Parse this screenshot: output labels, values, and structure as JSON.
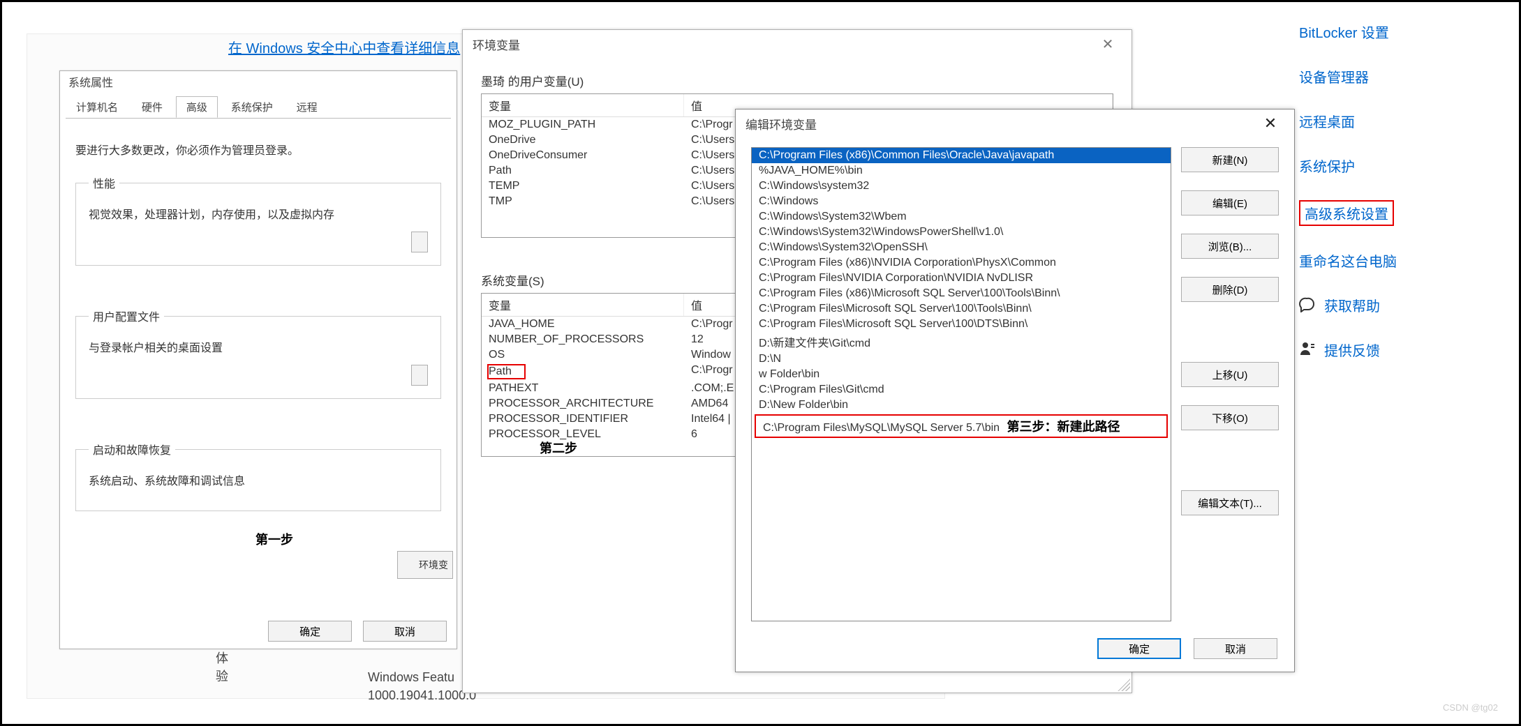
{
  "right_links": {
    "bitlocker": "BitLocker 设置",
    "device_manager": "设备管理器",
    "remote_desktop": "远程桌面",
    "system_protection": "系统保护",
    "advanced_system": "高级系统设置",
    "rename_pc": "重命名这台电脑",
    "get_help": "获取帮助",
    "give_feedback": "提供反馈"
  },
  "background": {
    "details_link": "在 Windows 安全中心中查看详细信息",
    "experience_label": "体验",
    "feature_text": "Windows Featu",
    "version_text": "1000.19041.1000.0"
  },
  "sysprops": {
    "title": "系统属性",
    "tabs": [
      "计算机名",
      "硬件",
      "高级",
      "系统保护",
      "远程"
    ],
    "active_tab_index": 2,
    "admin_note": "要进行大多数更改，你必须作为管理员登录。",
    "perf_group": "性能",
    "perf_desc": "视觉效果，处理器计划，内存使用，以及虚拟内存",
    "profile_group": "用户配置文件",
    "profile_desc": "与登录帐户相关的桌面设置",
    "startup_group": "启动和故障恢复",
    "startup_desc": "系统启动、系统故障和调试信息",
    "step1_label": "第一步",
    "envvar_btn": "环境变",
    "ok": "确定",
    "cancel": "取消"
  },
  "envvars": {
    "title": "环境变量",
    "user_section": "墨琦 的用户变量(U)",
    "sys_section": "系统变量(S)",
    "col_var": "变量",
    "col_val": "值",
    "user_vars": [
      {
        "name": "MOZ_PLUGIN_PATH",
        "value": "C:\\Progr"
      },
      {
        "name": "OneDrive",
        "value": "C:\\Users"
      },
      {
        "name": "OneDriveConsumer",
        "value": "C:\\Users"
      },
      {
        "name": "Path",
        "value": "C:\\Users"
      },
      {
        "name": "TEMP",
        "value": "C:\\Users"
      },
      {
        "name": "TMP",
        "value": "C:\\Users"
      }
    ],
    "sys_vars": [
      {
        "name": "JAVA_HOME",
        "value": "C:\\Progr"
      },
      {
        "name": "NUMBER_OF_PROCESSORS",
        "value": "12"
      },
      {
        "name": "OS",
        "value": "Window"
      },
      {
        "name": "Path",
        "value": "C:\\Progr"
      },
      {
        "name": "PATHEXT",
        "value": ".COM;.E"
      },
      {
        "name": "PROCESSOR_ARCHITECTURE",
        "value": "AMD64"
      },
      {
        "name": "PROCESSOR_IDENTIFIER",
        "value": "Intel64 |"
      },
      {
        "name": "PROCESSOR_LEVEL",
        "value": "6"
      }
    ],
    "step2_label": "第二步"
  },
  "editenv": {
    "title": "编辑环境变量",
    "paths": [
      "C:\\Program Files (x86)\\Common Files\\Oracle\\Java\\javapath",
      "%JAVA_HOME%\\bin",
      "C:\\Windows\\system32",
      "C:\\Windows",
      "C:\\Windows\\System32\\Wbem",
      "C:\\Windows\\System32\\WindowsPowerShell\\v1.0\\",
      "C:\\Windows\\System32\\OpenSSH\\",
      "C:\\Program Files (x86)\\NVIDIA Corporation\\PhysX\\Common",
      "C:\\Program Files\\NVIDIA Corporation\\NVIDIA NvDLISR",
      "C:\\Program Files (x86)\\Microsoft SQL Server\\100\\Tools\\Binn\\",
      "C:\\Program Files\\Microsoft SQL Server\\100\\Tools\\Binn\\",
      "C:\\Program Files\\Microsoft SQL Server\\100\\DTS\\Binn\\",
      "D:\\新建文件夹\\Git\\cmd",
      "D:\\N",
      "w Folder\\bin",
      "C:\\Program Files\\Git\\cmd",
      "D:\\New Folder\\bin",
      "C:\\Program Files\\MySQL\\MySQL Server 5.7\\bin"
    ],
    "selected_index": 0,
    "boxed_index": 17,
    "step3_label": "第三步：新建此路径",
    "buttons": {
      "new": "新建(N)",
      "edit": "编辑(E)",
      "browse": "浏览(B)...",
      "delete": "删除(D)",
      "move_up": "上移(U)",
      "move_down": "下移(O)",
      "edit_text": "编辑文本(T)..."
    },
    "ok": "确定",
    "cancel": "取消"
  },
  "watermark": "CSDN @tg02"
}
